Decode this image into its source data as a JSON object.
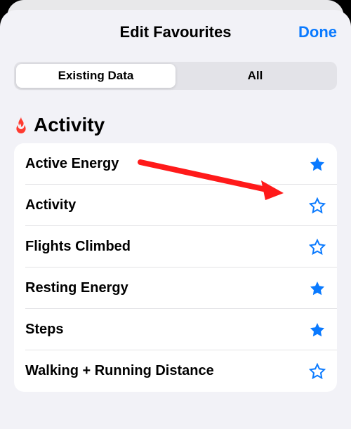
{
  "header": {
    "title": "Edit Favourites",
    "done": "Done"
  },
  "segmented": {
    "items": [
      "Existing Data",
      "All"
    ],
    "selected_index": 0
  },
  "section": {
    "icon": "flame-icon",
    "title": "Activity",
    "rows": [
      {
        "label": "Active Energy",
        "favourite": true
      },
      {
        "label": "Activity",
        "favourite": false
      },
      {
        "label": "Flights Climbed",
        "favourite": false
      },
      {
        "label": "Resting Energy",
        "favourite": true
      },
      {
        "label": "Steps",
        "favourite": true
      },
      {
        "label": "Walking + Running Distance",
        "favourite": false
      }
    ]
  },
  "colors": {
    "accent": "#0a7aff",
    "destructive": "#ff3b30"
  },
  "annotation": {
    "arrow_target_row_index": 0
  }
}
